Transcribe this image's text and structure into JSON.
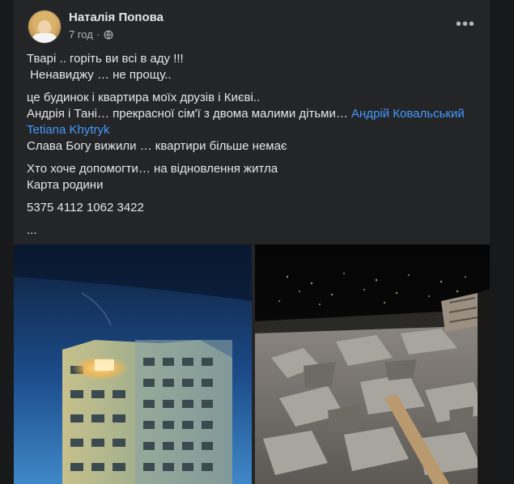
{
  "post": {
    "author": "Наталія Попова",
    "time": "7 год",
    "privacy_icon": "globe-icon",
    "more_icon": "more-horizontal-icon",
    "more_label": "•••",
    "lines": {
      "l1": "Тварі .. горіть ви всі в аду !!!",
      "l2": " Ненавиджу … не прощу..",
      "l3": "це будинок і квартира моїх друзів і Києві..",
      "l4": "Андрія і Тані… прекрасної сім'ї з двома малими дітьми… ",
      "tag1": "Андрій Ковальський",
      "tag2": "Tetiana Khytryk",
      "l5": "Слава Богу вижили … квартири більше немає",
      "l6": "Хто хоче допомогти… на відновлення житла",
      "l7": "Карта родини",
      "l8": "5375 4112 1062 3422",
      "l9": "..."
    },
    "photos": [
      "photo-building-night",
      "photo-destroyed-apartment-rubble"
    ]
  }
}
